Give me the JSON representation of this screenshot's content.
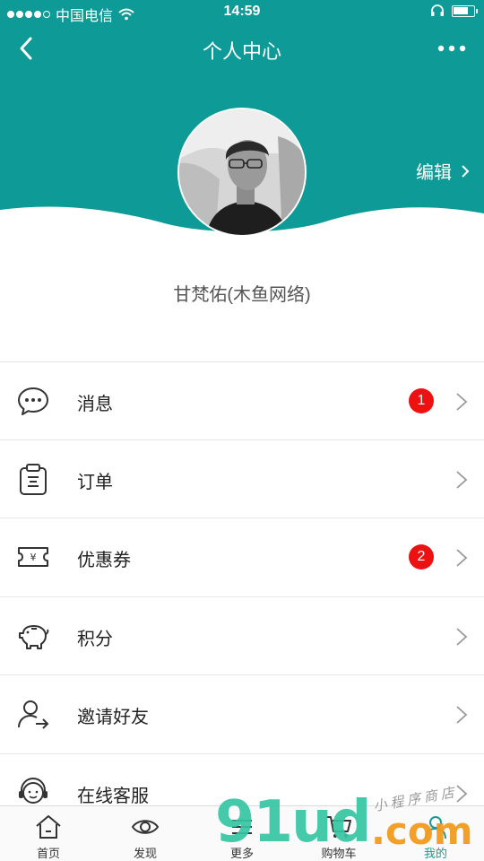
{
  "status_bar": {
    "carrier": "中国电信",
    "time": "14:59",
    "battery_level": 0.75
  },
  "nav": {
    "title": "个人中心"
  },
  "profile": {
    "edit_label": "编辑",
    "username": "甘梵佑(木鱼网络)"
  },
  "menu": [
    {
      "label": "消息",
      "icon": "message-icon",
      "badge": "1"
    },
    {
      "label": "订单",
      "icon": "order-clipboard-icon",
      "badge": ""
    },
    {
      "label": "优惠券",
      "icon": "coupon-icon",
      "badge": "2"
    },
    {
      "label": "积分",
      "icon": "piggy-bank-icon",
      "badge": ""
    },
    {
      "label": "邀请好友",
      "icon": "invite-user-icon",
      "badge": ""
    },
    {
      "label": "在线客服",
      "icon": "customer-service-icon",
      "badge": ""
    }
  ],
  "tabbar": [
    {
      "label": "首页",
      "icon": "home-icon"
    },
    {
      "label": "发现",
      "icon": "eye-icon"
    },
    {
      "label": "更多",
      "icon": "more-grid-icon"
    },
    {
      "label": "购物车",
      "icon": "cart-icon"
    },
    {
      "label": "我的",
      "icon": "user-icon",
      "active": true
    }
  ],
  "watermark": {
    "brand": "91ud",
    "domain": ".com",
    "tagline": "小程序商店"
  },
  "colors": {
    "theme": "#0e9a96",
    "badge": "#ee1111",
    "active_tab": "#1a9a94"
  }
}
